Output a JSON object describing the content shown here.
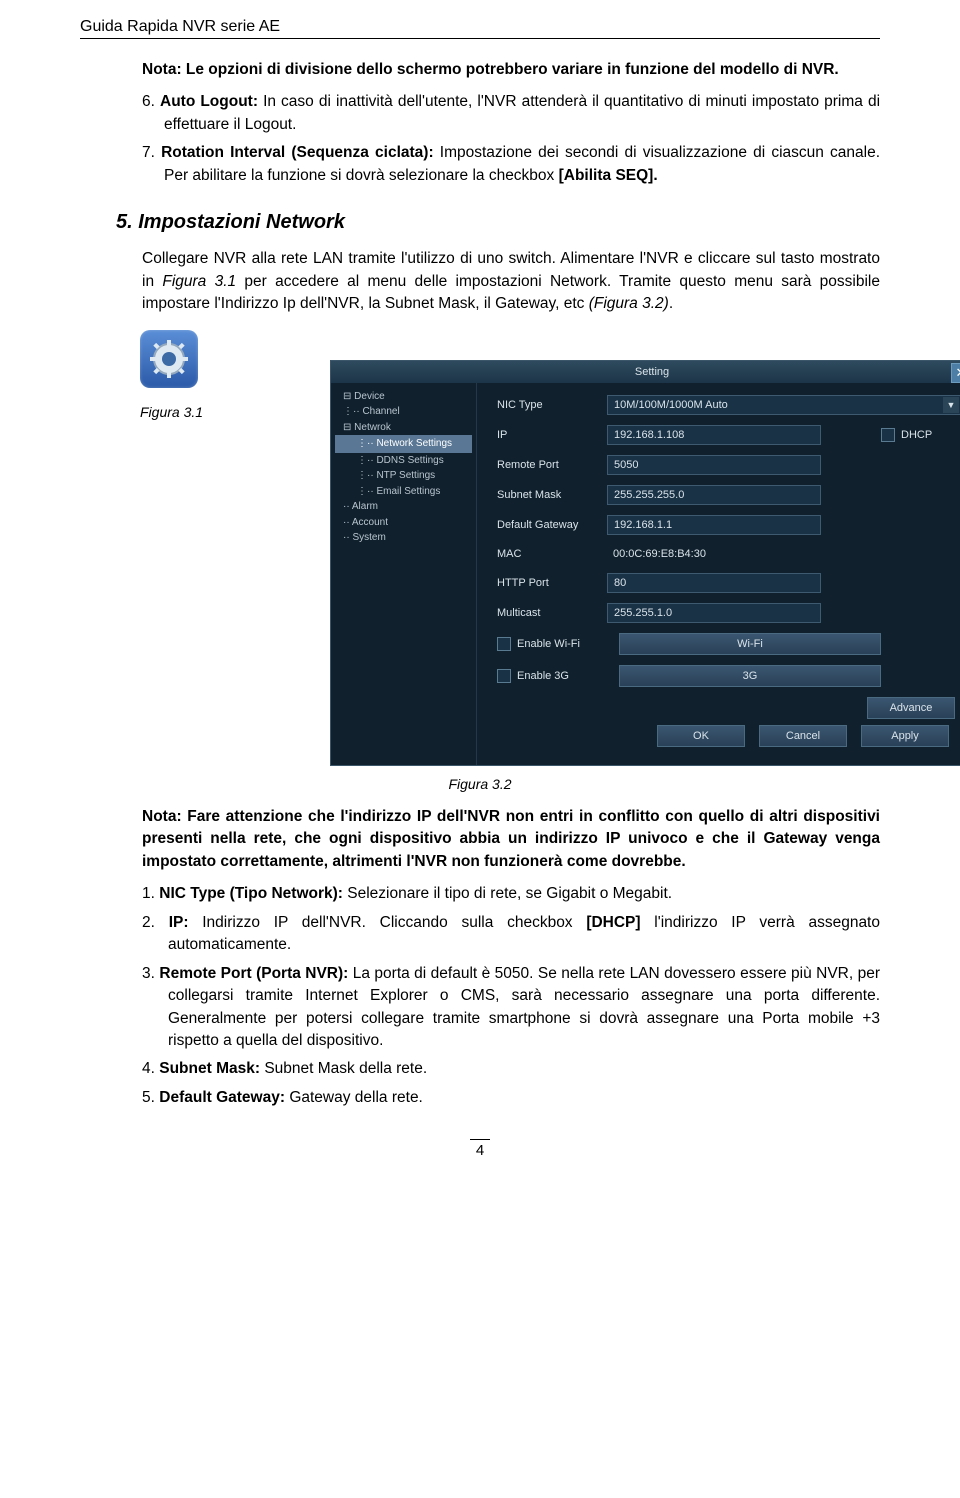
{
  "header": "Guida Rapida NVR serie AE",
  "note1": "Nota: Le opzioni di divisione dello schermo potrebbero variare in funzione del modello di NVR.",
  "list1": {
    "i6": {
      "n": "6.",
      "pre": "Auto Logout:",
      "text": " In caso di inattività dell'utente, l'NVR attenderà il quantitativo di minuti impostato prima di effettuare il Logout."
    },
    "i7": {
      "n": "7.",
      "pre": "Rotation Interval (Sequenza ciclata):",
      "text": " Impostazione dei secondi di visualizzazione di ciascun canale. Per abilitare la funzione si dovrà selezionare la checkbox ",
      "post": "[Abilita SEQ]."
    }
  },
  "section5": {
    "num": "5.",
    "title": "Impostazioni Network"
  },
  "para1": {
    "a": "Collegare NVR alla rete LAN tramite l'utilizzo di uno switch. Alimentare l'NVR e cliccare sul tasto mostrato in ",
    "fig1": "Figura 3.1",
    "b": " per accedere al menu delle impostazioni Network. Tramite questo menu sarà possibile impostare l'Indirizzo Ip dell'NVR, la Subnet Mask, il Gateway, etc ",
    "fig2": "(Figura 3.2)",
    "c": "."
  },
  "figcap1": "Figura 3.1",
  "figcap2": "Figura 3.2",
  "settings": {
    "title": "Setting",
    "tree": {
      "device": "Device",
      "channel": "Channel",
      "netwrok": "Netwrok",
      "network_settings": "Network Settings",
      "ddns": "DDNS Settings",
      "ntp": "NTP Settings",
      "email": "Email Settings",
      "alarm": "Alarm",
      "account": "Account",
      "system": "System"
    },
    "fields": {
      "nic_type": {
        "label": "NIC Type",
        "value": "10M/100M/1000M Auto"
      },
      "ip": {
        "label": "IP",
        "value": "192.168.1.108"
      },
      "dhcp": "DHCP",
      "remote_port": {
        "label": "Remote Port",
        "value": "5050"
      },
      "subnet": {
        "label": "Subnet Mask",
        "value": "255.255.255.0"
      },
      "gateway": {
        "label": "Default Gateway",
        "value": "192.168.1.1"
      },
      "mac": {
        "label": "MAC",
        "value": "00:0C:69:E8:B4:30"
      },
      "http": {
        "label": "HTTP Port",
        "value": "80"
      },
      "multicast": {
        "label": "Multicast",
        "value": "255.255.1.0"
      },
      "wifi_en": "Enable Wi-Fi",
      "wifi_btn": "Wi-Fi",
      "g3_en": "Enable 3G",
      "g3_btn": "3G",
      "advance": "Advance"
    },
    "buttons": {
      "ok": "OK",
      "cancel": "Cancel",
      "apply": "Apply"
    }
  },
  "note2": "Nota: Fare attenzione che l'indirizzo IP dell'NVR non entri in conflitto con quello di altri dispositivi presenti nella rete, che ogni dispositivo abbia un indirizzo IP univoco e che il Gateway venga impostato correttamente, altrimenti l'NVR non funzionerà come dovrebbe.",
  "list2": {
    "i1": {
      "n": "1.",
      "pre": "NIC Type (Tipo Network):",
      "text": " Selezionare il tipo di rete, se Gigabit o Megabit."
    },
    "i2": {
      "n": "2.",
      "pre": "IP:",
      "text": " Indirizzo IP dell'NVR. Cliccando sulla checkbox ",
      "mid": "[DHCP]",
      "post": " l'indirizzo IP verrà assegnato automaticamente."
    },
    "i3": {
      "n": "3.",
      "pre": "Remote Port (Porta NVR):",
      "text": " La porta di default è 5050. Se nella rete LAN dovessero essere più NVR, per collegarsi tramite Internet Explorer o CMS, sarà necessario assegnare una porta differente. Generalmente per potersi collegare tramite smartphone si dovrà assegnare una Porta mobile +3 rispetto a quella del dispositivo."
    },
    "i4": {
      "n": "4.",
      "pre": "Subnet Mask:",
      "text": " Subnet Mask della rete."
    },
    "i5": {
      "n": "5.",
      "pre": "Default Gateway:",
      "text": " Gateway della rete."
    }
  },
  "page_num": "4"
}
